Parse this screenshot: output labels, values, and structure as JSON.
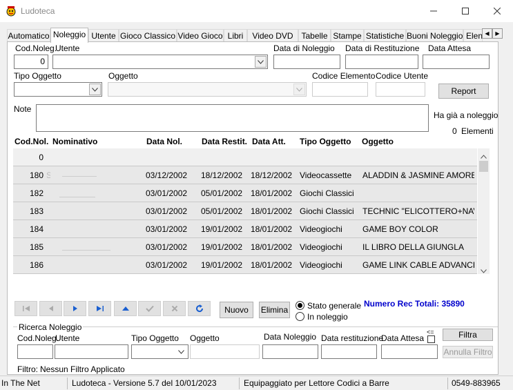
{
  "window": {
    "title": "Ludoteca"
  },
  "tabs": [
    {
      "label": "Automatico"
    },
    {
      "label": "Noleggio"
    },
    {
      "label": "Utente"
    },
    {
      "label": "Gioco Classico"
    },
    {
      "label": "Video Gioco"
    },
    {
      "label": "Libri"
    },
    {
      "label": "Video DVD"
    },
    {
      "label": "Tabelle"
    },
    {
      "label": "Stampe"
    },
    {
      "label": "Statistiche"
    },
    {
      "label": "Buoni Noleggio"
    },
    {
      "label": "Elen"
    }
  ],
  "form": {
    "cod_noleg_label": "Cod.Noleg.",
    "cod_noleg_value": "0",
    "utente_label": "Utente",
    "data_noleggio_label": "Data di Noleggio",
    "data_restituzione_label": "Data di Restituzione",
    "data_attesa_label": "Data Attesa",
    "tipo_oggetto_label": "Tipo Oggetto",
    "oggetto_label": "Oggetto",
    "codice_elemento_label": "Codice Elemento",
    "codice_utente_label": "Codice Utente",
    "report_label": "Report",
    "note_label": "Note",
    "ha_gia_label": "Ha già a noleggio",
    "elementi_count": "0",
    "elementi_label": "Elementi"
  },
  "grid": {
    "headers": [
      "Cod.Nol.",
      "Nominativo",
      "Data Nol.",
      "Data Restit.",
      "Data Att.",
      "Tipo Oggetto",
      "Oggetto"
    ],
    "rows": [
      {
        "cod": "0",
        "nome": "",
        "nol": "",
        "rest": "",
        "att": "",
        "tipo": "",
        "ogg": ""
      },
      {
        "cod": "180",
        "nome": "S",
        "nol": "03/12/2002",
        "rest": "18/12/2002",
        "att": "18/12/2002",
        "tipo": "Videocassette",
        "ogg": "ALADDIN & JASMINE AMORE AI"
      },
      {
        "cod": "182",
        "nome": "",
        "nol": "03/01/2002",
        "rest": "05/01/2002",
        "att": "18/01/2002",
        "tipo": "Giochi Classici",
        "ogg": ""
      },
      {
        "cod": "183",
        "nome": "",
        "nol": "03/01/2002",
        "rest": "05/01/2002",
        "att": "18/01/2002",
        "tipo": "Giochi Classici",
        "ogg": "TECHNIC \"ELICOTTERO+NAVE"
      },
      {
        "cod": "184",
        "nome": "",
        "nol": "03/01/2002",
        "rest": "19/01/2002",
        "att": "18/01/2002",
        "tipo": "Videogiochi",
        "ogg": "GAME BOY COLOR"
      },
      {
        "cod": "185",
        "nome": "",
        "nol": "03/01/2002",
        "rest": "19/01/2002",
        "att": "18/01/2002",
        "tipo": "Videogiochi",
        "ogg": "IL LIBRO DELLA GIUNGLA"
      },
      {
        "cod": "186",
        "nome": "",
        "nol": "03/01/2002",
        "rest": "19/01/2002",
        "att": "18/01/2002",
        "tipo": "Videogiochi",
        "ogg": "GAME LINK CABLE  ADVANCE ("
      }
    ]
  },
  "actions": {
    "nuovo_label": "Nuovo",
    "elimina_label": "Elimina",
    "stato_generale_label": "Stato generale",
    "in_noleggio_label": "In noleggio",
    "numero_rec_label": "Numero Rec Totali: 35890"
  },
  "ricerca": {
    "title": "Ricerca Noleggio",
    "cod_label": "Cod.Noleg.",
    "utente_label": "Utente",
    "tipo_label": "Tipo Oggetto",
    "oggetto_label": "Oggetto",
    "data_noleggio_label": "Data Noleggio",
    "data_restituzione_label": "Data restituzione",
    "data_attesa_label": "Data Attesa",
    "le_symbol": "<=",
    "filtra_label": "Filtra",
    "annulla_label": "Annulla Filtro",
    "filtro_label": "Filtro:",
    "filtro_value": "Nessun Filtro Applicato"
  },
  "statusbar": {
    "company": "In The Net",
    "version": "Ludoteca - Versione 5.7 del 10/01/2023",
    "equip": "Equipaggiato per Lettore Codici a Barre",
    "phone": "0549-883965"
  },
  "colors": {
    "accent_blue": "#0000cc",
    "nav_icon_blue": "#1a5fd0"
  }
}
